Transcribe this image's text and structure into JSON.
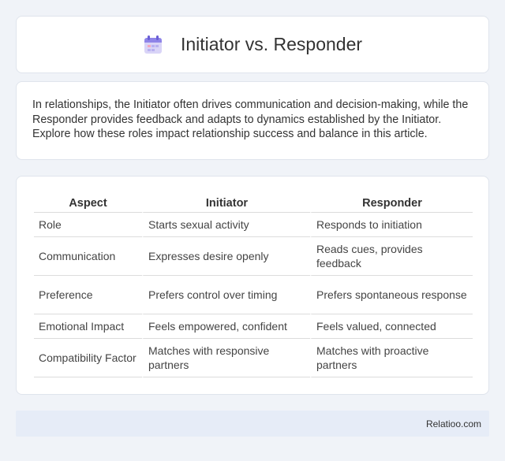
{
  "header": {
    "title": "Initiator vs. Responder",
    "icon": "calendar-icon"
  },
  "intro": {
    "text": "In relationships, the Initiator often drives communication and decision-making, while the Responder provides feedback and adapts to dynamics established by the Initiator. Explore how these roles impact relationship success and balance in this article."
  },
  "table": {
    "headers": [
      "Aspect",
      "Initiator",
      "Responder"
    ],
    "rows": [
      [
        "Role",
        "Starts sexual activity",
        "Responds to initiation"
      ],
      [
        "Communication",
        "Expresses desire openly",
        "Reads cues, provides feedback"
      ],
      [
        "Preference",
        "Prefers control over timing",
        "Prefers spontaneous response"
      ],
      [
        "Emotional Impact",
        "Feels empowered, confident",
        "Feels valued, connected"
      ],
      [
        "Compatibility Factor",
        "Matches with responsive partners",
        "Matches with proactive partners"
      ]
    ]
  },
  "footer": {
    "brand": "Relatioo.com"
  },
  "colors": {
    "background": "#f0f3f8",
    "footer_bg": "#e6ecf7",
    "card_border": "#dfe4ec"
  }
}
